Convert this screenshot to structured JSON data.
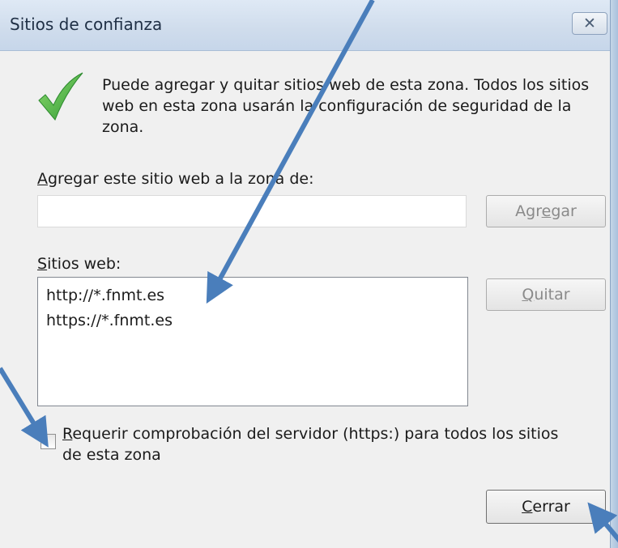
{
  "window": {
    "title": "Sitios de confianza",
    "close_glyph": "✕"
  },
  "info": {
    "icon": "checkmark-icon",
    "line1": "Puede agregar y quitar sitios web de esta zona. Todos los sitios",
    "line2": "web en esta zona usarán la configuración de seguridad de la",
    "line3": "zona."
  },
  "add_section": {
    "label_mnemonic": "A",
    "label_rest": "gregar este sitio web a la zona de:",
    "input_value": "",
    "button_before": "Agr",
    "button_mnemonic": "e",
    "button_after": "gar"
  },
  "sites_section": {
    "label_mnemonic": "S",
    "label_rest": "itios web:",
    "items": [
      "http://*.fnmt.es",
      "https://*.fnmt.es"
    ],
    "remove_mnemonic": "Q",
    "remove_rest": "uitar"
  },
  "https_option": {
    "checked": false,
    "line1_mnemonic": "R",
    "line1_rest": "equerir comprobación del servidor (https:) para todos los sitios",
    "line2": "de esta zona"
  },
  "close_button": {
    "mnemonic": "C",
    "rest": "errar"
  },
  "colors": {
    "annotation_arrow": "#4a7ebb",
    "checkmark": "#3fae3f",
    "dialog_bg": "#f0f0f0",
    "titlebar": "#d3e0ef"
  }
}
